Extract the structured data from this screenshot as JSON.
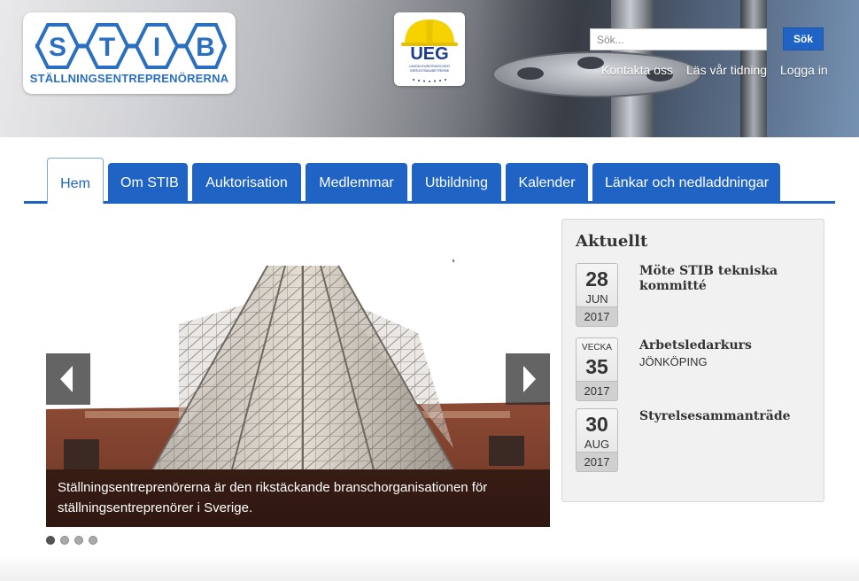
{
  "header": {
    "logo": {
      "letters": [
        "S",
        "T",
        "I",
        "B"
      ],
      "tagline": "STÄLLNINGSENTREPRENÖRERNA"
    },
    "partner_logo": {
      "text": "UEG",
      "subtext": "UNION EUROPÄISCHER GERÜSTBAUBETRIEBE"
    },
    "search": {
      "placeholder": "Sök...",
      "value": "",
      "button_label": "Sök"
    },
    "links": [
      "Kontakta oss",
      "Läs vår tidning",
      "Logga in"
    ]
  },
  "nav": {
    "tabs": [
      {
        "label": "Hem",
        "active": true
      },
      {
        "label": "Om STIB"
      },
      {
        "label": "Auktorisation"
      },
      {
        "label": "Medlemmar"
      },
      {
        "label": "Utbildning"
      },
      {
        "label": "Kalender"
      },
      {
        "label": "Länkar och nedladdningar"
      }
    ]
  },
  "slider": {
    "caption": "Ställningsentreprenörerna är den rikstäckande branschorganisationen för ställningsentreprenörer i Sverige.",
    "slide_count": 4,
    "active_slide": 1,
    "prev_icon": "chevron-left-icon",
    "next_icon": "chevron-right-icon"
  },
  "news": {
    "title": "Aktuellt",
    "events": [
      {
        "day": "28",
        "month": "JUN",
        "year": "2017",
        "title": "Möte STIB tekniska kommitté",
        "subtitle": ""
      },
      {
        "week_label": "VECKA",
        "week": "35",
        "year": "2017",
        "title": "Arbetsledarkurs",
        "subtitle": "JÖNKÖPING"
      },
      {
        "day": "30",
        "month": "AUG",
        "year": "2017",
        "title": "Styrelsesammanträde",
        "subtitle": ""
      }
    ]
  },
  "colors": {
    "brand_blue": "#1f64c4",
    "logo_blue": "#2a6fc0",
    "ueg_yellow": "#f5d200",
    "ueg_navy": "#1b3c8e"
  }
}
